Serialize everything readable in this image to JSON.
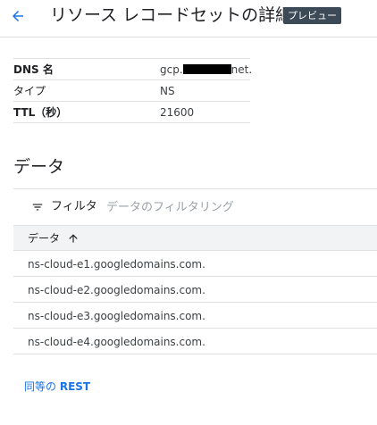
{
  "header": {
    "title": "リソース レコードセットの詳細",
    "badge": "プレビュー"
  },
  "details": {
    "rows": [
      {
        "key": "DNS 名",
        "value_prefix": "gcp.",
        "value_suffix": "net."
      },
      {
        "key": "タイプ",
        "value": "NS"
      },
      {
        "key": "TTL（秒）",
        "value": "21600"
      }
    ]
  },
  "data_section": {
    "title": "データ",
    "filter": {
      "label": "フィルタ",
      "placeholder": "データのフィルタリング"
    },
    "column_header": "データ",
    "rows": [
      "ns-cloud-e1.googledomains.com.",
      "ns-cloud-e2.googledomains.com.",
      "ns-cloud-e3.googledomains.com.",
      "ns-cloud-e4.googledomains.com."
    ]
  },
  "footer": {
    "link_prefix": "同等の",
    "link_strong": "REST"
  },
  "colors": {
    "accent": "#1a73e8",
    "badge_bg": "#3c4a57",
    "header_row_bg": "#f1f3f4"
  },
  "icons": {
    "back": "arrow-back-icon",
    "filter": "filter-list-icon",
    "sort": "arrow-upward-icon"
  }
}
